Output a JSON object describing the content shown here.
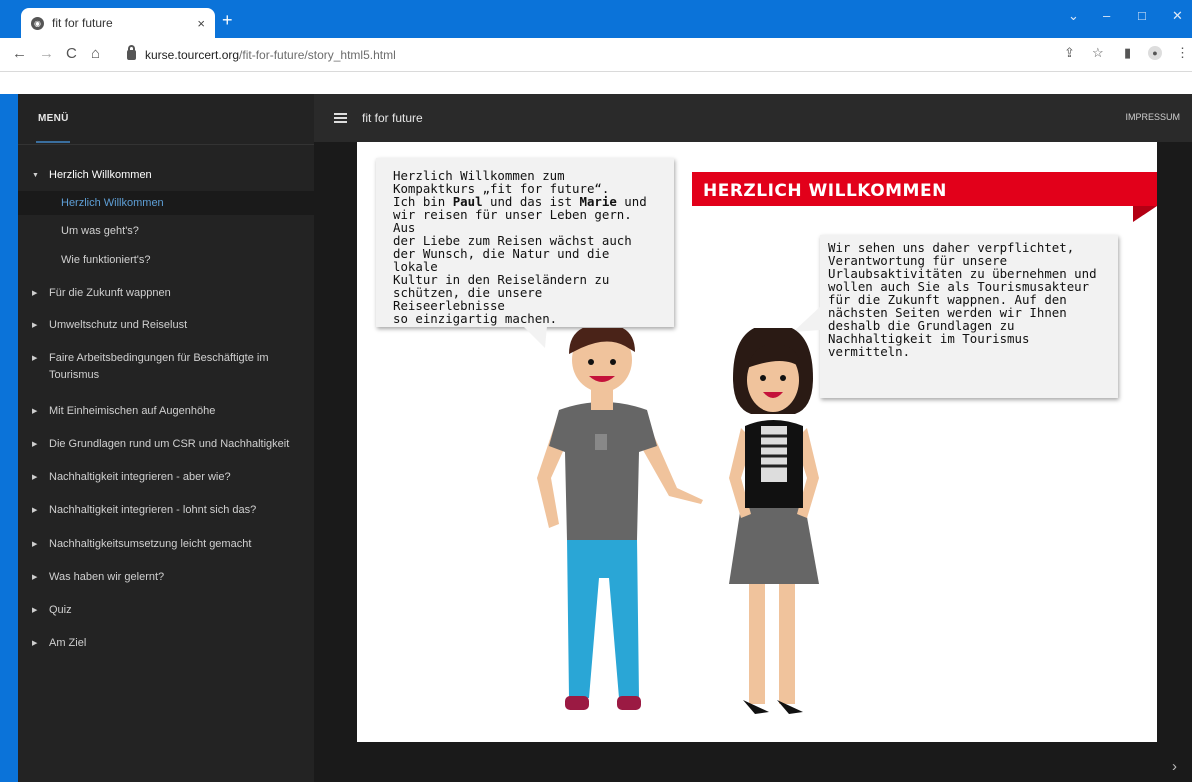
{
  "browser": {
    "tab_title": "fit for future",
    "tab_close": "×",
    "new_tab": "+",
    "window_controls": [
      "⌄",
      "–",
      "□",
      "✕"
    ],
    "url_host": "kurse.tourcert.org",
    "url_path": "/fit-for-future/story_html5.html",
    "nav_icons": [
      "arrow-left-icon",
      "arrow-right-icon",
      "reload-icon",
      "home-icon"
    ],
    "toolbar_icons": [
      "share-icon",
      "star-icon",
      "sidepanel-icon",
      "profile-icon",
      "kebab-menu-icon"
    ]
  },
  "sidebar": {
    "title": "MENÜ",
    "items": [
      {
        "label": "Herzlich Willkommen",
        "level": 0,
        "state": "open"
      },
      {
        "label": "Herzlich Willkommen",
        "level": 1,
        "state": "active"
      },
      {
        "label": "Um was geht's?",
        "level": 1,
        "state": ""
      },
      {
        "label": "Wie funktioniert's?",
        "level": 1,
        "state": ""
      },
      {
        "label": "Für die Zukunft wappnen",
        "level": 0,
        "state": ""
      },
      {
        "label": "Umweltschutz und Reiselust",
        "level": 0,
        "state": ""
      },
      {
        "label": "Faire Arbeitsbedingungen für Beschäftigte im Tourismus",
        "level": 0,
        "state": ""
      },
      {
        "label": "Mit Einheimischen auf Augenhöhe",
        "level": 0,
        "state": ""
      },
      {
        "label": "Die Grundlagen rund um CSR und Nachhaltigkeit",
        "level": 0,
        "state": ""
      },
      {
        "label": "Nachhaltigkeit integrieren - aber wie?",
        "level": 0,
        "state": ""
      },
      {
        "label": "Nachhaltigkeit integrieren - lohnt sich das?",
        "level": 0,
        "state": ""
      },
      {
        "label": "Nachhaltigkeitsumsetzung leicht gemacht",
        "level": 0,
        "state": ""
      },
      {
        "label": "Was haben wir gelernt?",
        "level": 0,
        "state": ""
      },
      {
        "label": "Quiz",
        "level": 0,
        "state": ""
      },
      {
        "label": "Am Ziel",
        "level": 0,
        "state": ""
      }
    ]
  },
  "topbar": {
    "course_title": "fit for future",
    "impressum": "IMPRESSUM"
  },
  "slide": {
    "heading": "HERZLICH WILLKOMMEN",
    "bubble1_line1": "Herzlich Willkommen zum\nKompaktkurs „fit for future“.\nIch bin ",
    "bubble1_name1": "Paul",
    "bubble1_mid": " und das ist ",
    "bubble1_name2": "Marie",
    "bubble1_rest": " und\nwir reisen für unser Leben gern. Aus\nder Liebe zum Reisen wächst auch\nder Wunsch, die Natur und die lokale\nKultur in den Reiseländern zu\nschützen, die unsere Reiseerlebnisse\nso einzigartig machen.",
    "bubble2": "Wir sehen uns daher verpflichtet,\nVerantwortung für unsere\nUrlaubsaktivitäten zu übernehmen und\nwollen auch Sie als Tourismusakteur\nfür die Zukunft wappnen. Auf den\nnächsten Seiten werden wir Ihnen\ndeshalb die Grundlagen zu\nNachhaltigkeit im Tourismus\nvermitteln.",
    "colors": {
      "ribbon": "#e2001a",
      "bubble": "#f2f2f2",
      "accent_blue": "#5e9fd6"
    }
  },
  "player": {
    "next_label": "›"
  }
}
